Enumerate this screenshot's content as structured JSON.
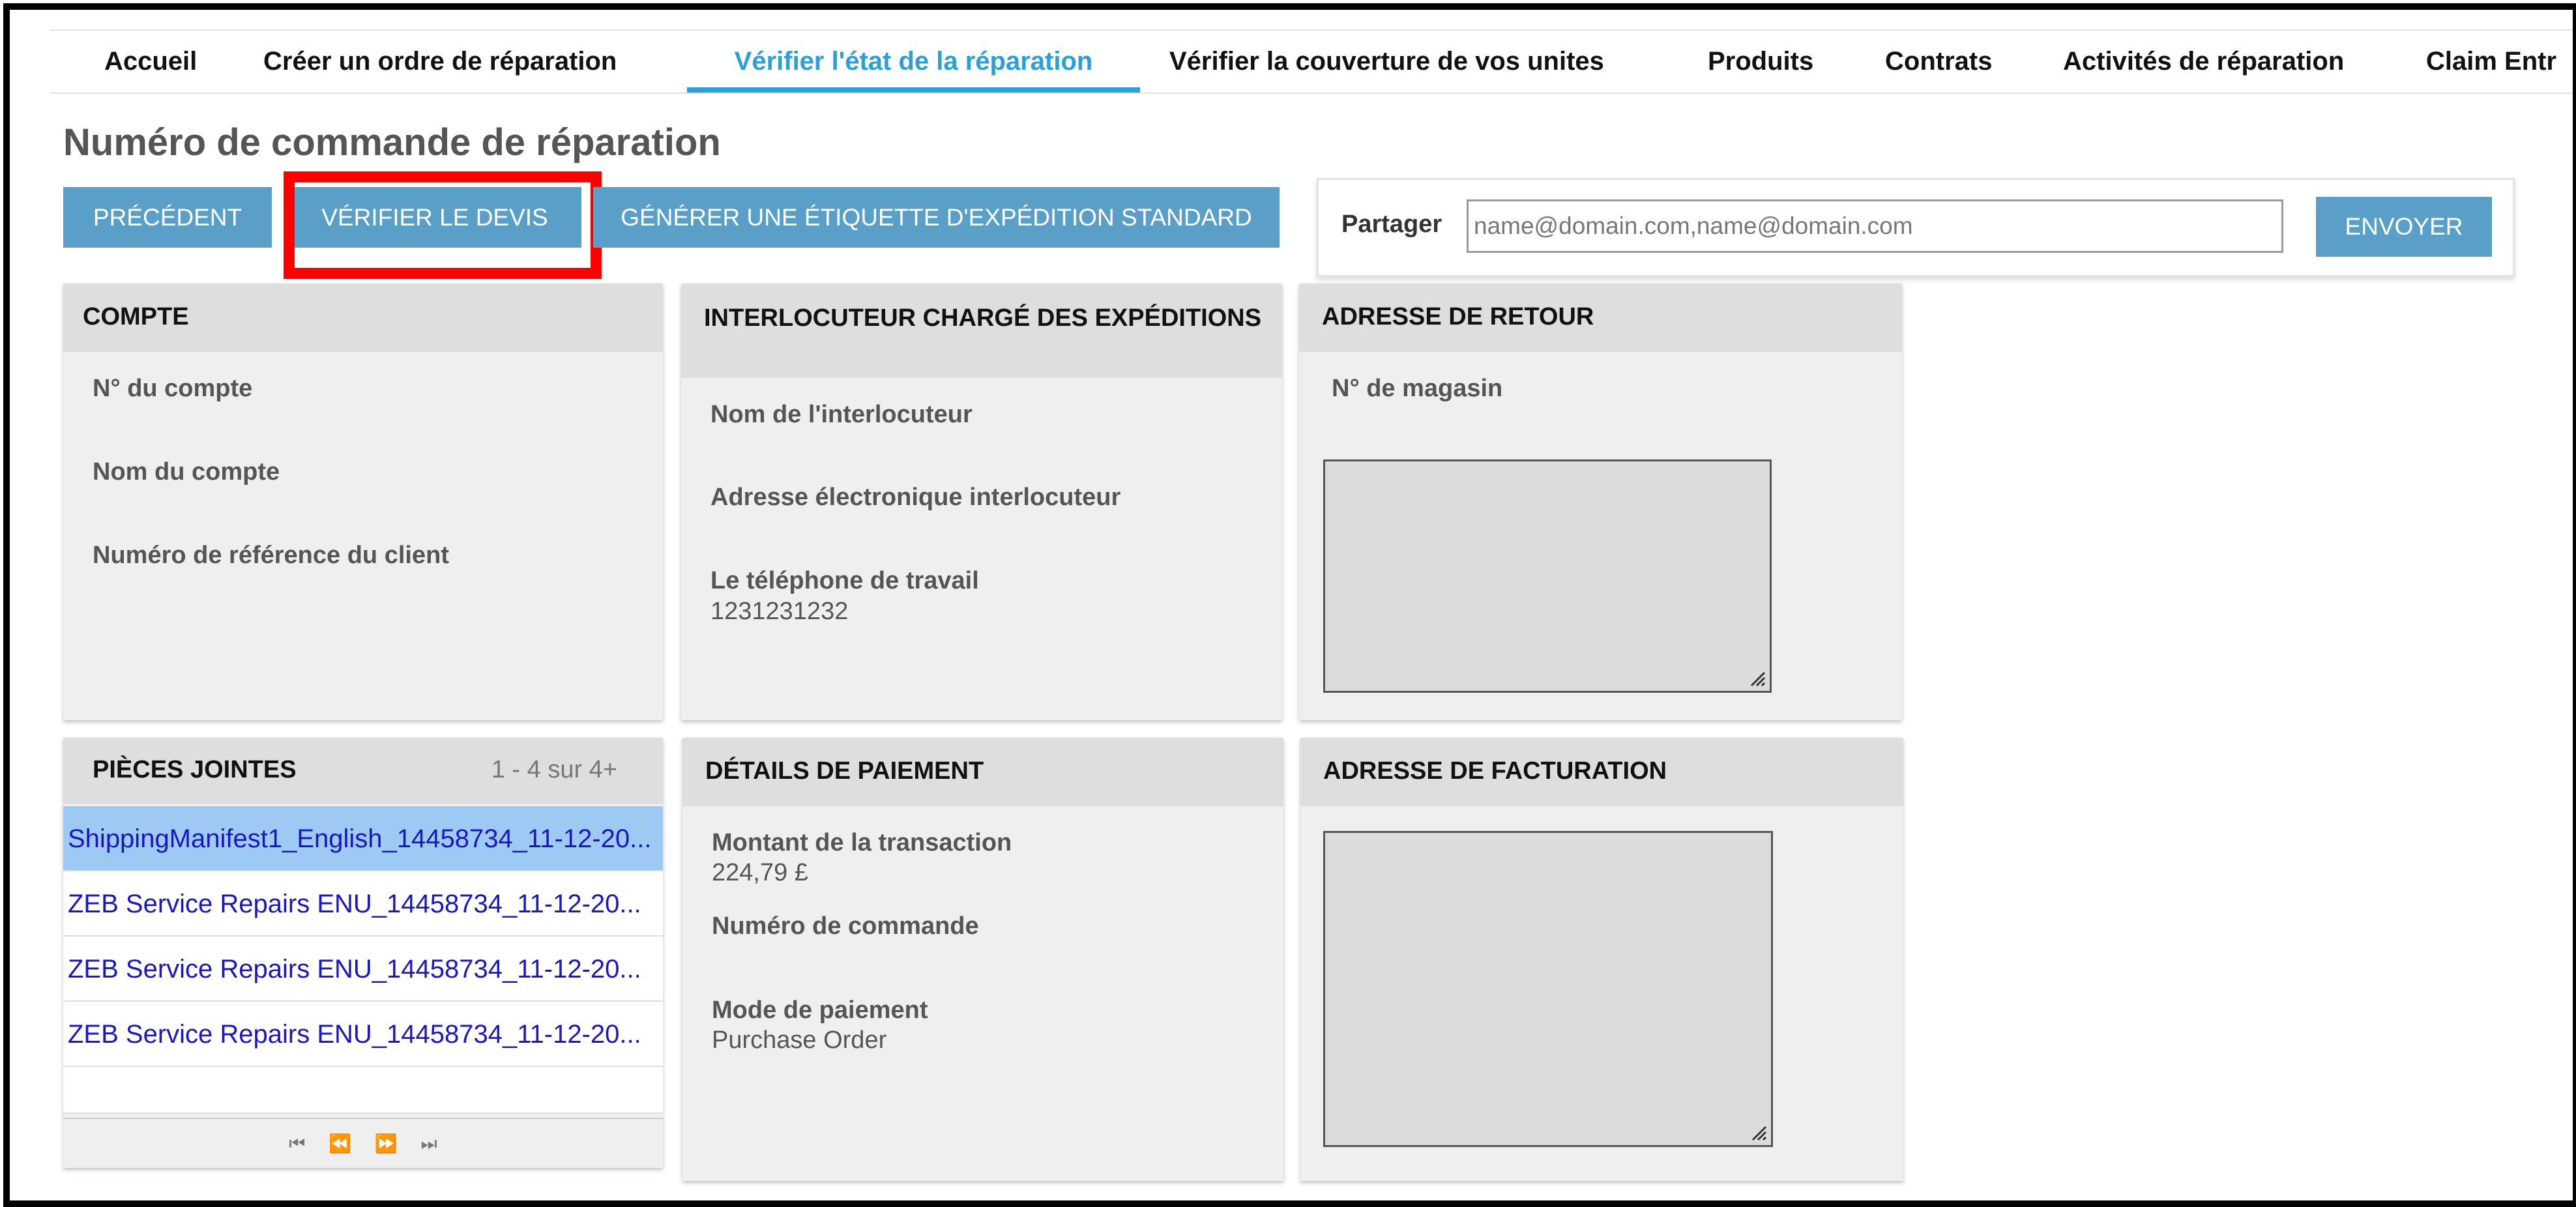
{
  "tabs": [
    {
      "label": "Accueil",
      "active": false
    },
    {
      "label": "Créer un ordre de réparation",
      "active": false
    },
    {
      "label": "Vérifier l'état de la réparation",
      "active": true
    },
    {
      "label": "Vérifier la couverture de vos unites",
      "active": false
    },
    {
      "label": "Produits",
      "active": false
    },
    {
      "label": "Contrats",
      "active": false
    },
    {
      "label": "Activités de réparation",
      "active": false
    },
    {
      "label": "Claim Entr",
      "active": false
    }
  ],
  "page": {
    "title": "Numéro de commande de réparation"
  },
  "toolbar": {
    "previous": "PRÉCÉDENT",
    "verify_quote": "VÉRIFIER LE DEVIS",
    "generate_label": "GÉNÉRER UNE ÉTIQUETTE D'EXPÉDITION STANDARD"
  },
  "share": {
    "label": "Partager",
    "placeholder": "name@domain.com,name@domain.com",
    "send": "ENVOYER"
  },
  "account": {
    "title": "COMPTE",
    "number_label": "N° du compte",
    "name_label": "Nom du compte",
    "ref_label": "Numéro de référence du client"
  },
  "shipping_contact": {
    "title": "INTERLOCUTEUR CHARGÉ DES EXPÉDITIONS",
    "name_label": "Nom de l'interlocuteur",
    "email_label": "Adresse électronique interlocuteur",
    "phone_label": "Le téléphone de travail",
    "phone_value": "1231231232"
  },
  "return_address": {
    "title": "ADRESSE DE RETOUR",
    "store_label": "N° de magasin"
  },
  "attachments": {
    "title": "PIÈCES JOINTES",
    "count": "1 - 4 sur 4+",
    "items": [
      "ShippingManifest1_English_14458734_11-12-20...",
      "ZEB Service Repairs ENU_14458734_11-12-20...",
      "ZEB Service Repairs ENU_14458734_11-12-20...",
      "ZEB Service Repairs ENU_14458734_11-12-20..."
    ],
    "pager": [
      "⏮",
      "⏪",
      "⏩",
      "⏭"
    ]
  },
  "payment": {
    "title": "DÉTAILS DE PAIEMENT",
    "amount_label": "Montant de la transaction",
    "amount_value": "224,79 £",
    "order_label": "Numéro de commande",
    "method_label": "Mode de paiement",
    "method_value": "Purchase Order"
  },
  "billing_address": {
    "title": "ADRESSE DE FACTURATION"
  },
  "colors": {
    "accent": "#2a9fd8",
    "button": "#5a9fc8",
    "highlight": "#ff0000",
    "link": "#1a16c8"
  }
}
